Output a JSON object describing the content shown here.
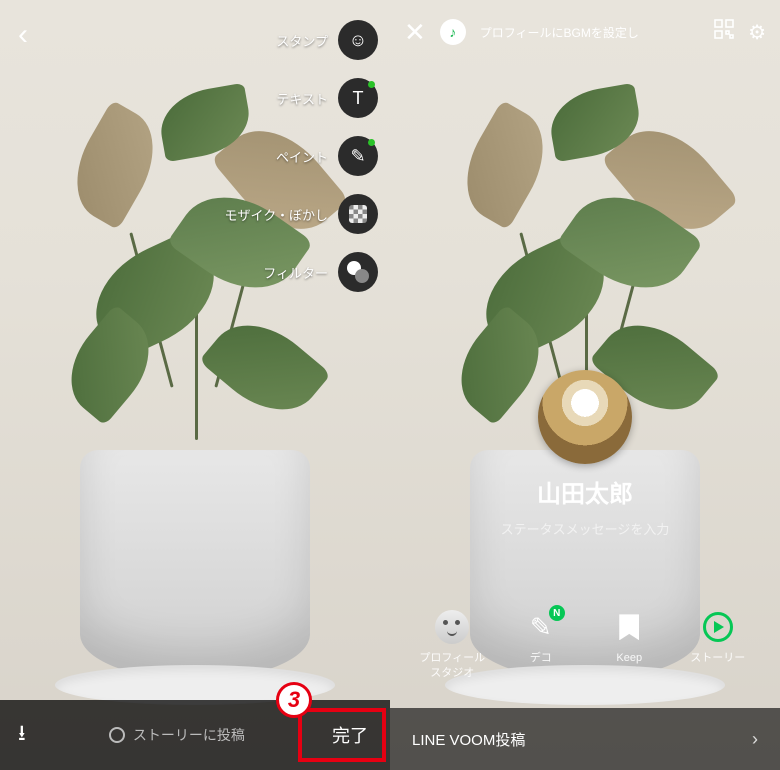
{
  "step_badge": "3",
  "left": {
    "tools": {
      "stamp": "スタンプ",
      "text": "テキスト",
      "paint": "ペイント",
      "mosaic": "モザイク・ぼかし",
      "filter": "フィルター"
    },
    "bottom": {
      "story_post": "ストーリーに投稿",
      "done": "完了"
    }
  },
  "right": {
    "top": {
      "bgm_hint": "プロフィールにBGMを設定し"
    },
    "profile": {
      "name": "山田太郎",
      "status_placeholder": "ステータスメッセージを入力"
    },
    "actions": {
      "studio": "プロフィール\nスタジオ",
      "deco": "デコ",
      "keep": "Keep",
      "story": "ストーリー",
      "deco_badge": "N"
    },
    "voom": "LINE VOOM投稿"
  }
}
